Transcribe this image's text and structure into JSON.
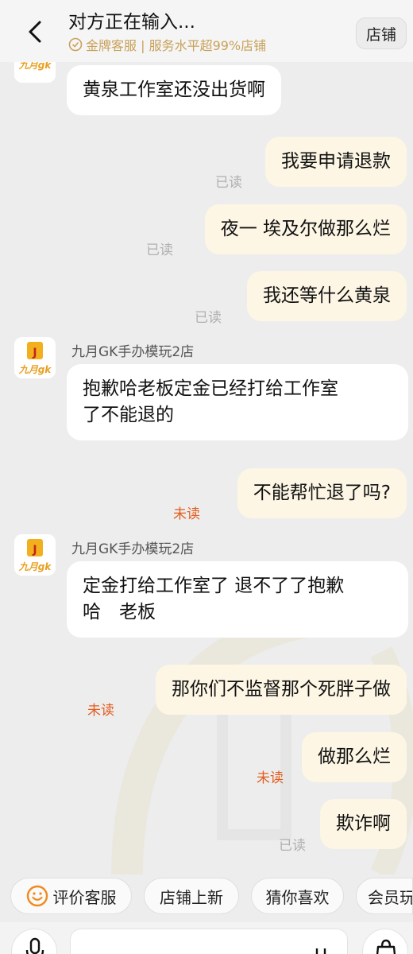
{
  "header": {
    "title": "对方正在输入...",
    "subtitle": "金牌客服 | 服务水平超99%店铺",
    "shop_button": "店铺"
  },
  "messages": {
    "m0": {
      "text": "黄泉工作室还没出货啊"
    },
    "m1": {
      "text": "我要申请退款",
      "status": "已读"
    },
    "m2": {
      "text": "夜一 埃及尔做那么烂",
      "status": "已读"
    },
    "m3": {
      "text": "我还等什么黄泉",
      "status": "已读"
    },
    "m4": {
      "sender": "九月GK手办模玩2店",
      "line1": "抱歉哈老板定金已经打给工作室",
      "line2": "了不能退的"
    },
    "m5": {
      "text": "不能帮忙退了吗?",
      "status": "未读"
    },
    "m6": {
      "sender": "九月GK手办模玩2店",
      "line1": "定金打给工作室了 退不了了抱歉",
      "line2": "哈　老板"
    },
    "m7": {
      "text": "那你们不监督那个死胖子做",
      "status": "未读"
    },
    "m8": {
      "text": "做那么烂",
      "status": "未读"
    },
    "m9": {
      "text": "欺诈啊",
      "status": "已读"
    }
  },
  "quick_actions": [
    "评价客服",
    "店铺上新",
    "猜你喜欢",
    "会员玩"
  ],
  "avatar_logo_text": "九月gk",
  "colors": {
    "unread": "#e25c1e",
    "read": "#b0b0b0",
    "outgoing_bubble": "#fdf6e5",
    "gold": "#c9a15a"
  }
}
